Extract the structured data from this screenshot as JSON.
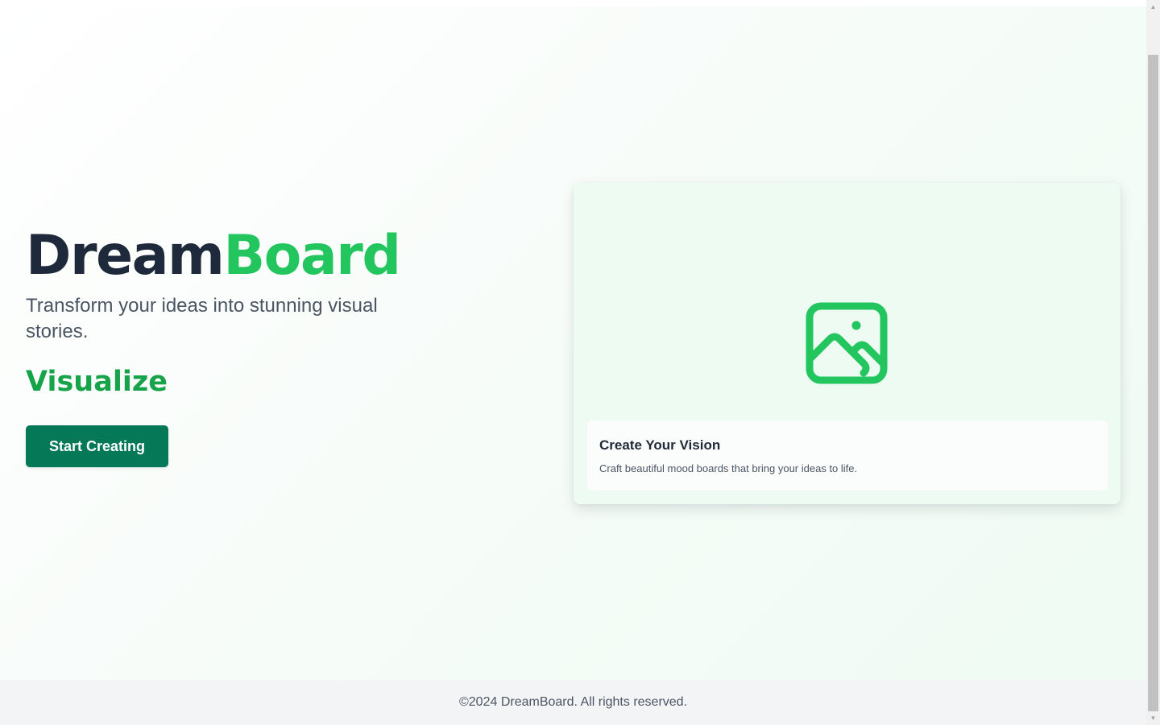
{
  "hero": {
    "brand_part1": "Dream",
    "brand_part2": "Board",
    "tagline": "Transform your ideas into stunning visual stories.",
    "rotating_word": "Visualize",
    "cta_label": "Start Creating"
  },
  "card": {
    "icon": "image-icon",
    "title": "Create Your Vision",
    "description": "Craft beautiful mood boards that bring your ideas to life."
  },
  "footer": {
    "copyright": "©2024 DreamBoard. All rights reserved."
  },
  "colors": {
    "accent_green": "#22c55e",
    "dark_text": "#1e293b",
    "cta_background": "#047857"
  }
}
